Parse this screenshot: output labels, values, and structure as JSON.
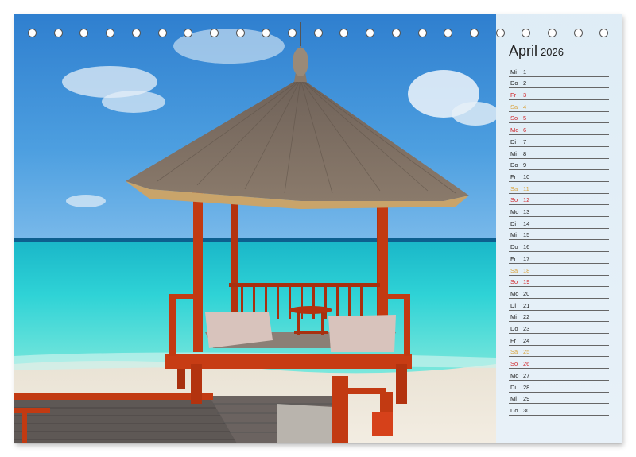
{
  "calendar": {
    "month": "April",
    "year": "2026",
    "days": [
      {
        "wd": "Mi",
        "d": "1",
        "type": "normal"
      },
      {
        "wd": "Do",
        "d": "2",
        "type": "normal"
      },
      {
        "wd": "Fr",
        "d": "3",
        "type": "hol"
      },
      {
        "wd": "Sa",
        "d": "4",
        "type": "sat"
      },
      {
        "wd": "So",
        "d": "5",
        "type": "sun"
      },
      {
        "wd": "Mo",
        "d": "6",
        "type": "hol"
      },
      {
        "wd": "Di",
        "d": "7",
        "type": "normal"
      },
      {
        "wd": "Mi",
        "d": "8",
        "type": "normal"
      },
      {
        "wd": "Do",
        "d": "9",
        "type": "normal"
      },
      {
        "wd": "Fr",
        "d": "10",
        "type": "normal"
      },
      {
        "wd": "Sa",
        "d": "11",
        "type": "sat"
      },
      {
        "wd": "So",
        "d": "12",
        "type": "sun"
      },
      {
        "wd": "Mo",
        "d": "13",
        "type": "normal"
      },
      {
        "wd": "Di",
        "d": "14",
        "type": "normal"
      },
      {
        "wd": "Mi",
        "d": "15",
        "type": "normal"
      },
      {
        "wd": "Do",
        "d": "16",
        "type": "normal"
      },
      {
        "wd": "Fr",
        "d": "17",
        "type": "normal"
      },
      {
        "wd": "Sa",
        "d": "18",
        "type": "sat"
      },
      {
        "wd": "So",
        "d": "19",
        "type": "sun"
      },
      {
        "wd": "Mo",
        "d": "20",
        "type": "normal"
      },
      {
        "wd": "Di",
        "d": "21",
        "type": "normal"
      },
      {
        "wd": "Mi",
        "d": "22",
        "type": "normal"
      },
      {
        "wd": "Do",
        "d": "23",
        "type": "normal"
      },
      {
        "wd": "Fr",
        "d": "24",
        "type": "normal"
      },
      {
        "wd": "Sa",
        "d": "25",
        "type": "sat"
      },
      {
        "wd": "So",
        "d": "26",
        "type": "sun"
      },
      {
        "wd": "Mo",
        "d": "27",
        "type": "normal"
      },
      {
        "wd": "Di",
        "d": "28",
        "type": "normal"
      },
      {
        "wd": "Mi",
        "d": "29",
        "type": "normal"
      },
      {
        "wd": "Do",
        "d": "30",
        "type": "normal"
      }
    ]
  },
  "colors": {
    "sunday": "#d0272b",
    "saturday": "#d9a23a",
    "sky": "#3f8fd6",
    "sea": "#2fd6d0"
  },
  "icons": {
    "binding": "spiral-binding-ring"
  }
}
